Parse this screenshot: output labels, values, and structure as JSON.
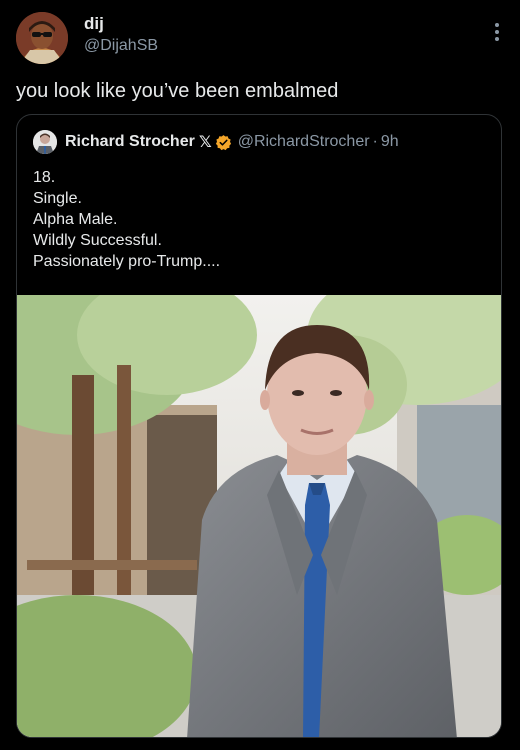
{
  "post": {
    "author": {
      "display_name": "dij",
      "handle": "@DijahSB",
      "avatar_icon": "profile-photo-avatar"
    },
    "menu_icon": "more-vertical-icon",
    "text": "you look like you’ve been embalmed"
  },
  "quoted_post": {
    "author": {
      "display_name": "Richard Strocher",
      "badge_x": "𝕏",
      "verified_icon": "verified-badge-icon",
      "handle": "@RichardStrocher",
      "separator": "·",
      "time": "9h"
    },
    "lines": [
      "18.",
      "Single.",
      "Alpha Male.",
      "Wildly Successful.",
      "Passionately pro-Trump...."
    ],
    "image": "photo of young man in grey suit and blue tie on tree-lined street"
  },
  "colors": {
    "background": "#000000",
    "text_primary": "#e7e9ea",
    "text_secondary": "#8b98a5",
    "border": "#2f3336",
    "verified": "#f4a62a"
  }
}
